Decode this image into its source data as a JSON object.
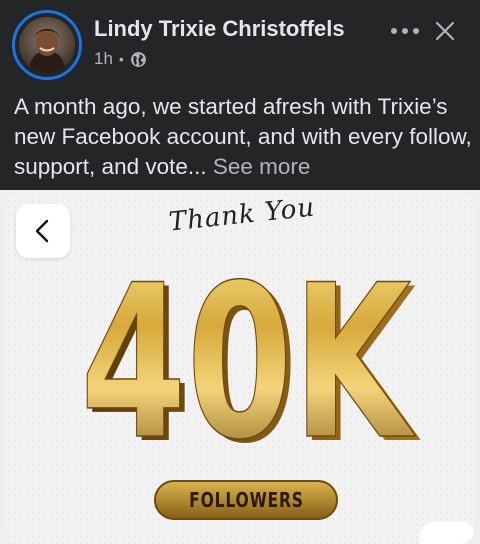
{
  "post": {
    "author": "Lindy Trixie Christoffels",
    "time": "1h",
    "separator": "•",
    "privacy_icon": "globe-icon",
    "caption": "A month ago, we started afresh with Trixie’s new Facebook account, and with every follow, support, and vote...",
    "see_more": "See more"
  },
  "media": {
    "thank_you": "Thank You",
    "count": "40K",
    "followers": "FOLLOWERS",
    "back_icon": "chevron-left-icon"
  },
  "colors": {
    "background": "#242526",
    "text_primary": "#e4e6eb",
    "text_secondary": "#b0b3b8",
    "avatar_ring": "#1b74e4",
    "gold": "#c9a13a"
  }
}
